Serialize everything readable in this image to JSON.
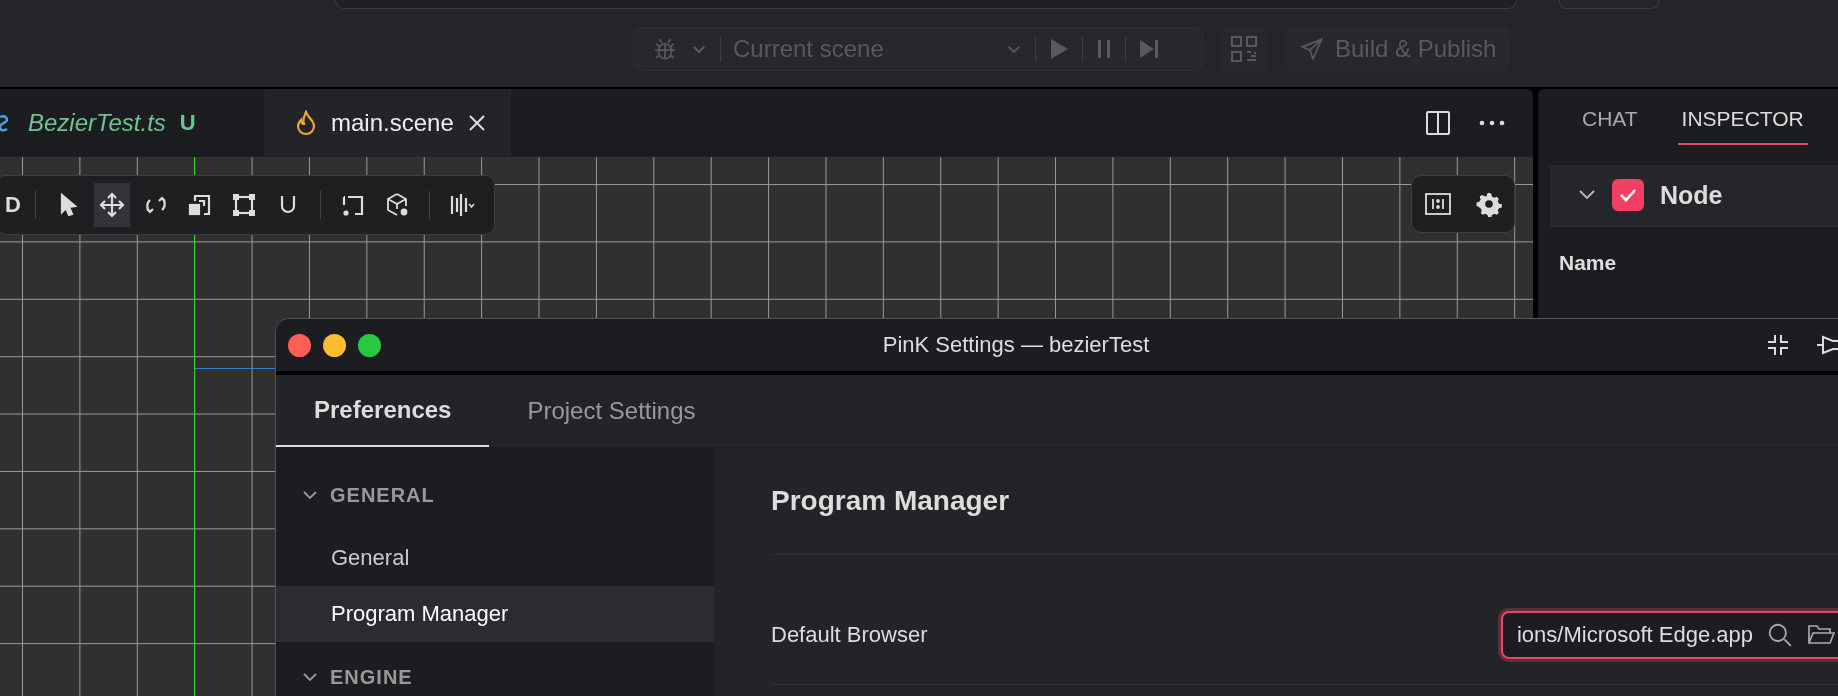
{
  "run_toolbar": {
    "scene": "Current scene",
    "build_button": "Build & Publish",
    "disabled": true
  },
  "editor_tabs": [
    {
      "label": "BezierTest.ts",
      "badge": "U",
      "selected": false
    },
    {
      "label": "main.scene",
      "selected": true
    }
  ],
  "scene_toolbar": {
    "mode": "D",
    "tools": [
      {
        "kind": "select",
        "selected": false
      },
      {
        "kind": "move",
        "selected": true
      },
      {
        "kind": "rotate",
        "selected": false
      },
      {
        "kind": "scale",
        "selected": false
      },
      {
        "kind": "rect",
        "selected": false
      },
      {
        "kind": "snap",
        "selected": false
      },
      {
        "kind": "anchor",
        "selected": false
      },
      {
        "kind": "pivot",
        "selected": false
      },
      {
        "kind": "align",
        "selected": false
      }
    ]
  },
  "inspector": {
    "tabs": [
      {
        "label": "CHAT",
        "selected": false
      },
      {
        "label": "INSPECTOR",
        "selected": true
      }
    ],
    "component": {
      "name": "Node",
      "checked": true,
      "expanded": true
    },
    "fields": [
      {
        "label": "Name"
      }
    ]
  },
  "settings_window": {
    "title": "PinK Settings — bezierTest",
    "tabs": [
      {
        "label": "Preferences",
        "selected": true
      },
      {
        "label": "Project Settings",
        "selected": false
      }
    ],
    "sidebar": [
      {
        "label": "GENERAL",
        "expanded": true,
        "items": [
          {
            "label": "General",
            "selected": false
          },
          {
            "label": "Program Manager",
            "selected": true
          }
        ]
      },
      {
        "label": "ENGINE",
        "expanded": true
      }
    ],
    "heading": "Program Manager",
    "rows": [
      {
        "label": "Default Browser",
        "value": "ions/Microsoft Edge.app",
        "focused": true
      }
    ]
  }
}
